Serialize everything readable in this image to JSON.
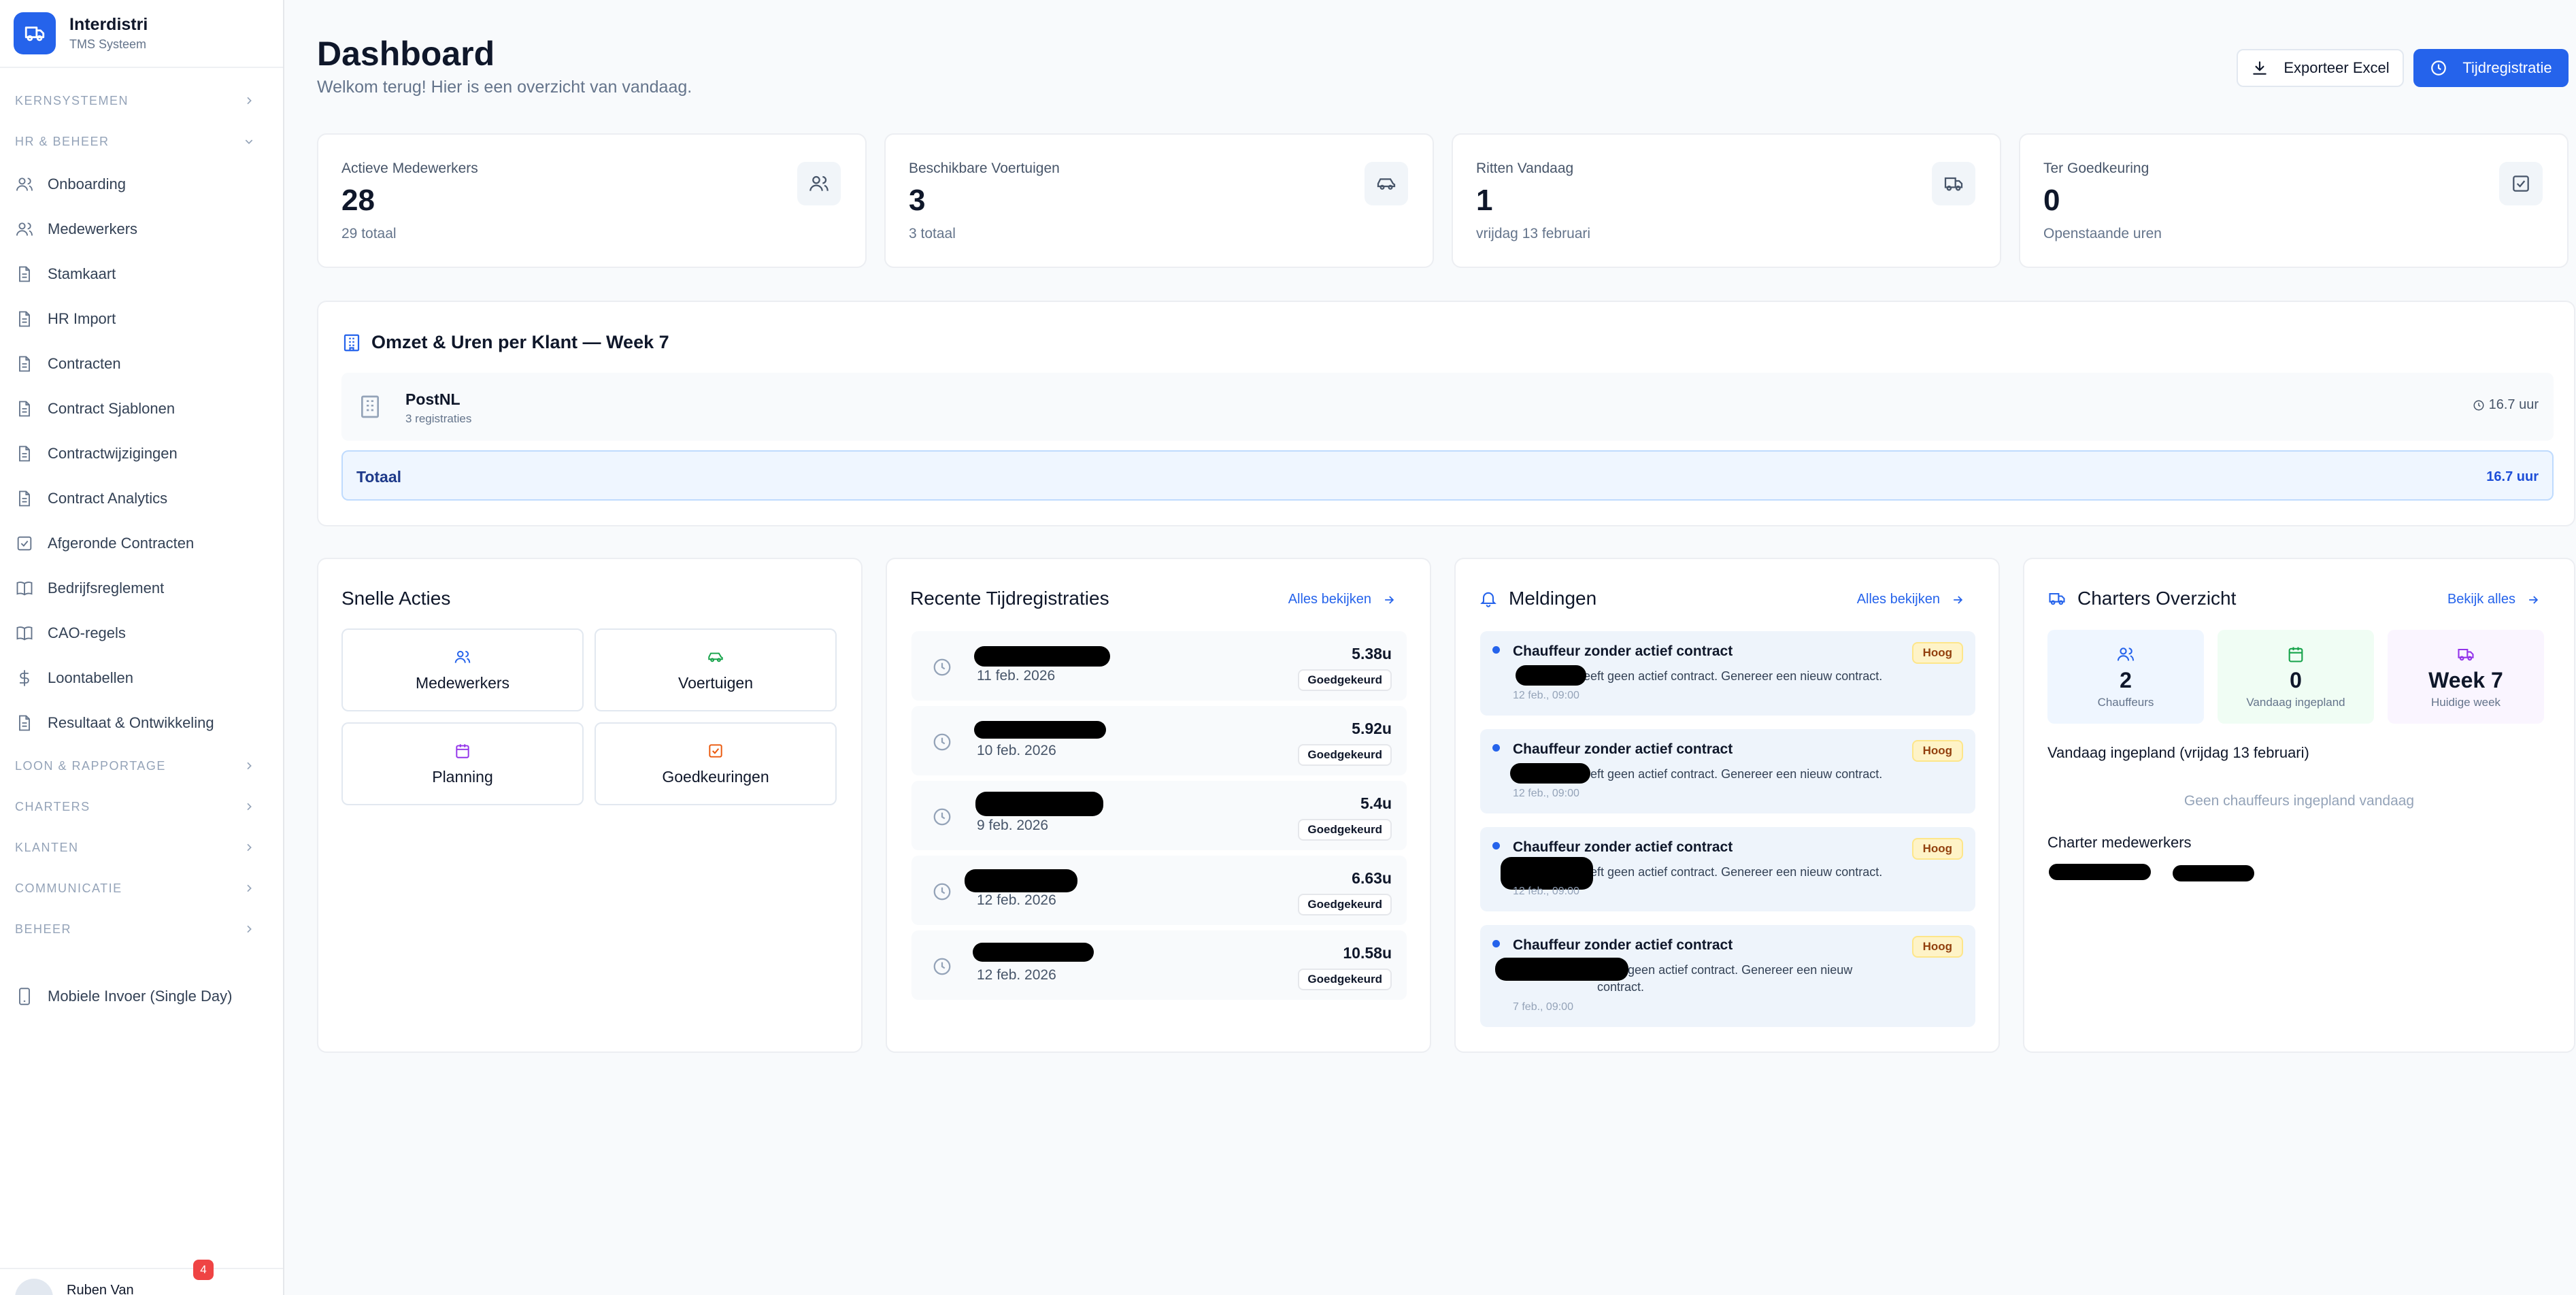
{
  "brand": {
    "title": "Interdistri",
    "subtitle": "TMS Systeem"
  },
  "sidebar": {
    "sections": {
      "kernsystemen": "Kernsystemen",
      "hr": "HR & Beheer",
      "loon": "Loon & Rapportage",
      "charters": "Charters",
      "klanten": "Klanten",
      "communicatie": "Communicatie",
      "beheer": "Beheer"
    },
    "items": [
      {
        "label": "Onboarding",
        "icon": "users-icon"
      },
      {
        "label": "Medewerkers",
        "icon": "users-icon"
      },
      {
        "label": "Stamkaart",
        "icon": "document-icon"
      },
      {
        "label": "HR Import",
        "icon": "document-icon"
      },
      {
        "label": "Contracten",
        "icon": "document-icon"
      },
      {
        "label": "Contract Sjablonen",
        "icon": "document-icon"
      },
      {
        "label": "Contractwijzigingen",
        "icon": "document-icon"
      },
      {
        "label": "Contract Analytics",
        "icon": "document-icon"
      },
      {
        "label": "Afgeronde Contracten",
        "icon": "check-square-icon"
      },
      {
        "label": "Bedrijfsreglement",
        "icon": "book-icon"
      },
      {
        "label": "CAO-regels",
        "icon": "book-icon"
      },
      {
        "label": "Loontabellen",
        "icon": "dollar-icon"
      },
      {
        "label": "Resultaat & Ontwikkeling",
        "icon": "document-icon"
      }
    ],
    "mobile": "Mobiele Invoer (Single Day)",
    "user_name": "Ruben Van",
    "user_badge": "4"
  },
  "header": {
    "title": "Dashboard",
    "subtitle": "Welkom terug! Hier is een overzicht van vandaag.",
    "export_label": "Exporteer Excel",
    "primary_label": "Tijdregistratie"
  },
  "stats": [
    {
      "label": "Actieve Medewerkers",
      "value": "28",
      "sub": "29 totaal",
      "icon": "users-icon"
    },
    {
      "label": "Beschikbare Voertuigen",
      "value": "3",
      "sub": "3 totaal",
      "icon": "car-icon"
    },
    {
      "label": "Ritten Vandaag",
      "value": "1",
      "sub": "vrijdag 13 februari",
      "icon": "truck-icon"
    },
    {
      "label": "Ter Goedkeuring",
      "value": "0",
      "sub": "Openstaande uren",
      "icon": "check-square-icon"
    }
  ],
  "revenue": {
    "title": "Omzet & Uren per Klant — Week 7",
    "client": "PostNL",
    "registrations": "3 registraties",
    "hours": "16.7 uur",
    "total_label": "Totaal",
    "total_value": "16.7 uur"
  },
  "quick_actions": {
    "title": "Snelle Acties",
    "items": [
      {
        "label": "Medewerkers",
        "icon": "users-icon",
        "color": "#2563eb"
      },
      {
        "label": "Voertuigen",
        "icon": "car-icon",
        "color": "#16a34a"
      },
      {
        "label": "Planning",
        "icon": "calendar-icon",
        "color": "#9333ea"
      },
      {
        "label": "Goedkeuringen",
        "icon": "check-square-icon",
        "color": "#ea580c"
      }
    ]
  },
  "time_registrations": {
    "title": "Recente Tijdregistraties",
    "link": "Alles bekijken",
    "rows": [
      {
        "name": "",
        "date": "11 feb. 2026",
        "hours": "5.38u",
        "status": "Goedgekeurd"
      },
      {
        "name": "",
        "date": "10 feb. 2026",
        "hours": "5.92u",
        "status": "Goedgekeurd"
      },
      {
        "name": "",
        "date": "9 feb. 2026",
        "hours": "5.4u",
        "status": "Goedgekeurd"
      },
      {
        "name": "",
        "date": "12 feb. 2026",
        "hours": "6.63u",
        "status": "Goedgekeurd"
      },
      {
        "name": "",
        "date": "12 feb. 2026",
        "hours": "10.58u",
        "status": "Goedgekeurd"
      }
    ]
  },
  "notifications": {
    "title": "Meldingen",
    "link": "Alles bekijken",
    "items": [
      {
        "title": "Chauffeur zonder actief contract",
        "message": "heeft geen actief contract. Genereer een nieuw contract.",
        "time": "12 feb., 09:00",
        "priority": "Hoog"
      },
      {
        "title": "Chauffeur zonder actief contract",
        "message": "heeft geen actief contract. Genereer een nieuw contract.",
        "time": "12 feb., 09:00",
        "priority": "Hoog"
      },
      {
        "title": "Chauffeur zonder actief contract",
        "message": "heeft geen actief contract. Genereer een nieuw contract.",
        "time": "12 feb., 09:00",
        "priority": "Hoog"
      },
      {
        "title": "Chauffeur zonder actief contract",
        "message": "heeft geen actief contract. Genereer een nieuw contract.",
        "time": "7 feb., 09:00",
        "priority": "Hoog"
      }
    ]
  },
  "charters": {
    "title": "Charters Overzicht",
    "link": "Bekijk alles",
    "stats": [
      {
        "value": "2",
        "label": "Chauffeurs",
        "icon": "users-icon",
        "color": "#2563eb",
        "bg": "#eff6ff"
      },
      {
        "value": "0",
        "label": "Vandaag ingepland",
        "icon": "calendar-icon",
        "color": "#16a34a",
        "bg": "#f0fdf4"
      },
      {
        "value": "Week 7",
        "label": "Huidige week",
        "icon": "truck-icon",
        "color": "#9333ea",
        "bg": "#faf5ff"
      }
    ],
    "planned_title": "Vandaag ingepland (vrijdag 13 februari)",
    "planned_empty": "Geen chauffeurs ingepland vandaag",
    "members_title": "Charter medewerkers"
  },
  "colors": {
    "accent": "#2563eb",
    "background": "#f8fafc",
    "warning_bg": "#fef3c7"
  }
}
